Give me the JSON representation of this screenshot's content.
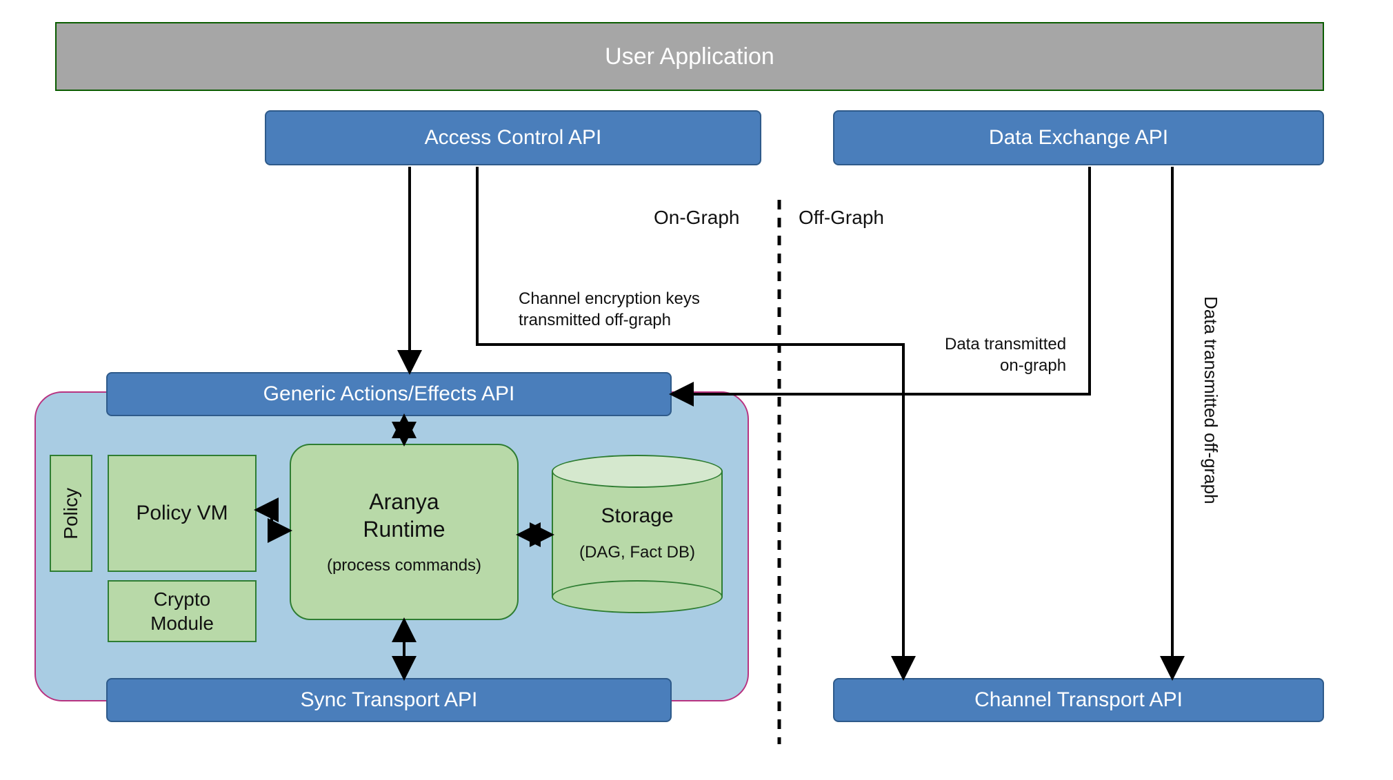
{
  "boxes": {
    "user_application": "User Application",
    "access_control_api": "Access Control API",
    "data_exchange_api": "Data Exchange API",
    "generic_actions_api": "Generic Actions/Effects API",
    "sync_transport_api": "Sync Transport API",
    "channel_transport_api": "Channel Transport API",
    "policy": "Policy",
    "policy_vm": "Policy VM",
    "crypto_module_l1": "Crypto",
    "crypto_module_l2": "Module",
    "aranya_runtime_l1": "Aranya",
    "aranya_runtime_l2": "Runtime",
    "aranya_runtime_sub": "(process commands)",
    "storage_title": "Storage",
    "storage_sub": "(DAG, Fact DB)"
  },
  "labels": {
    "on_graph": "On-Graph",
    "off_graph": "Off-Graph",
    "channel_keys_l1": "Channel encryption keys",
    "channel_keys_l2": "transmitted off-graph",
    "data_on_graph_l1": "Data transmitted",
    "data_on_graph_l2": "on-graph",
    "data_off_graph": "Data transmitted off-graph"
  }
}
